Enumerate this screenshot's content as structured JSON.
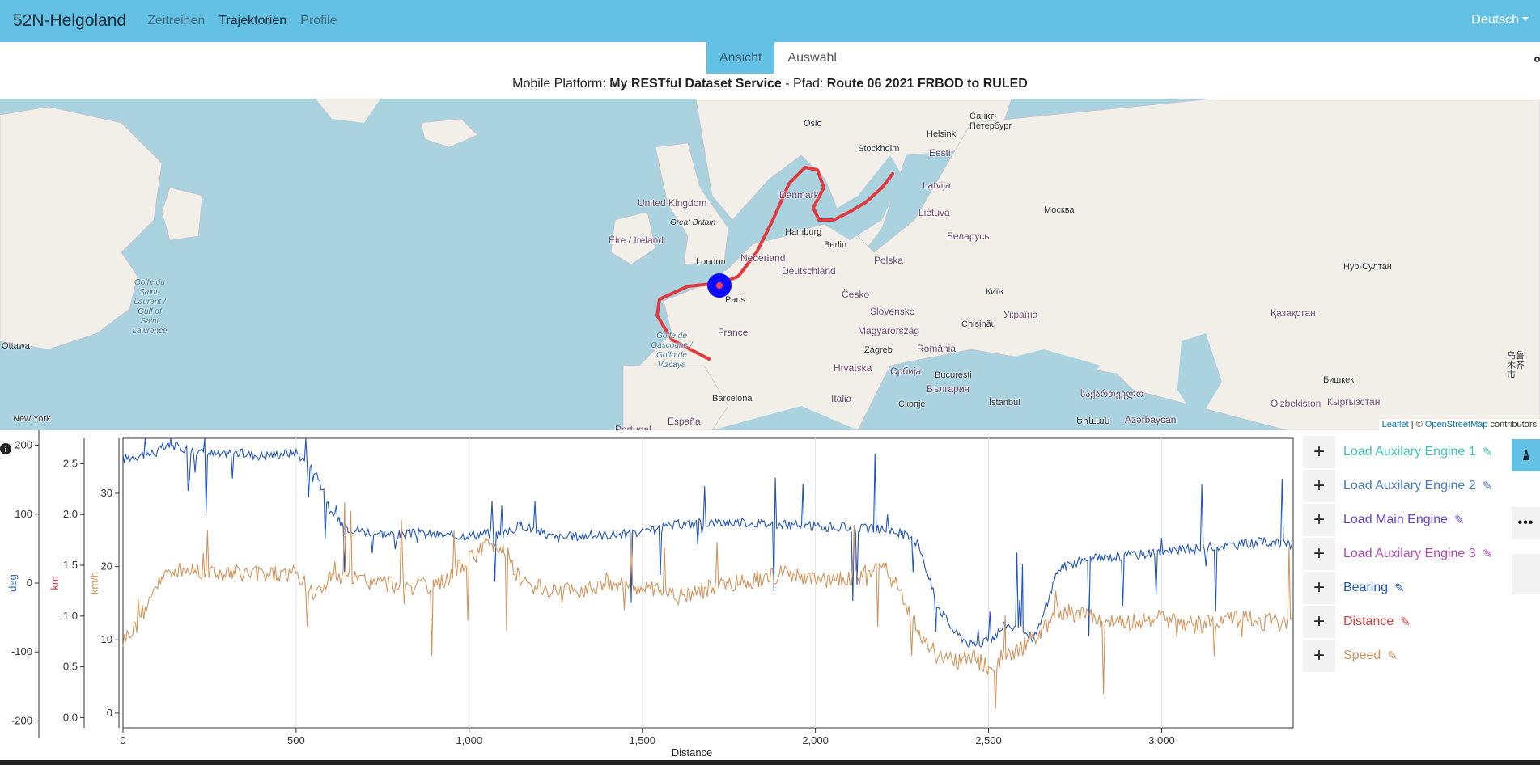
{
  "navbar": {
    "brand": "52N-Helgoland",
    "links": [
      "Zeitreihen",
      "Trajektorien",
      "Profile"
    ],
    "language": "Deutsch"
  },
  "tabs": [
    "Ansicht",
    "Auswahl"
  ],
  "subtitle": {
    "platform_label": "Mobile Platform:",
    "platform_value": "My RESTful Dataset Service",
    "sep": " - ",
    "path_label": "Pfad:",
    "path_value": "Route 06 2021 FRBOD to RULED"
  },
  "map": {
    "labels": {
      "oslo": "Oslo",
      "helsinki": "Helsinki",
      "spb": "Санкт-Петербург",
      "stockholm": "Stockholm",
      "eesti": "Eesti",
      "latvija": "Latvija",
      "lietuva": "Lietuva",
      "moskva": "Москва",
      "belarus": "Беларусь",
      "danmark": "Danmark",
      "uk": "United Kingdom",
      "gb": "Great Britain",
      "eire": "Éire / Ireland",
      "london": "London",
      "hamburg": "Hamburg",
      "berlin": "Berlin",
      "nederland": "Nederland",
      "deutschland": "Deutschland",
      "polska": "Polska",
      "paris": "Paris",
      "cesko": "Česko",
      "kyiv": "Київ",
      "ukraina": "Україна",
      "nur": "Нур-Султан",
      "kazakhstan": "Қазақстан",
      "france": "France",
      "slovensko": "Slovensko",
      "magyar": "Magyarország",
      "chisinau": "Chișinău",
      "zagreb": "Zagreb",
      "romania": "România",
      "hrvatska": "Hrvatska",
      "srbija": "Србија",
      "bucuresti": "București",
      "bulgaria": "България",
      "barcelona": "Barcelona",
      "italia": "Italia",
      "skopje": "Скопје",
      "istanbul": "İstanbul",
      "georgia": "საქართველო",
      "bishkek": "Бишкек",
      "uzbek": "O'zbekiston",
      "kyrgyz": "Кыргызстан",
      "urumqi": "乌鲁木齐市",
      "ottawa": "Ottawa",
      "newyork": "New York",
      "portugal": "Portugal",
      "espana": "España",
      "yerevan": "Երևան",
      "azerbaycan": "Azərbaycan",
      "golfe": "Golfe du Saint-Laurent / Gulf of Saint Lawrence",
      "gascogne": "Golfe de Gascogne / Golfo de Vizcaya"
    },
    "attribution": {
      "leaflet": "Leaflet",
      "sep": " | © ",
      "osm": "OpenStreetMap",
      "suffix": " contributors"
    }
  },
  "chart_data": {
    "type": "line",
    "xlabel": "Distance",
    "xlim": [
      0,
      3380
    ],
    "x_ticks": [
      "0",
      "500",
      "1,000",
      "1,500",
      "2,000",
      "2,500",
      "3,000"
    ],
    "axes": [
      {
        "label": "deg",
        "color": "#3366cc",
        "range": [
          -210,
          210
        ],
        "ticks": [
          "200",
          "100",
          "0",
          "-100",
          "-200"
        ]
      },
      {
        "label": "km",
        "color": "#e0393e",
        "range": [
          -0.1,
          2.75
        ],
        "ticks": [
          "2.5",
          "2.0",
          "1.5",
          "1.0",
          "0.5",
          "0.0"
        ]
      },
      {
        "label": "km/h",
        "color": "#d2955c",
        "range": [
          -2,
          37.5
        ],
        "ticks": [
          "30",
          "20",
          "10",
          "0"
        ]
      }
    ],
    "series": [
      {
        "name": "Bearing",
        "color": "#2255bb",
        "axis": 0,
        "x": [
          0,
          40,
          100,
          110,
          140,
          220,
          290,
          300,
          400,
          500,
          560,
          600,
          650,
          700,
          750,
          800,
          850,
          900,
          950,
          1000,
          1050,
          1100,
          1150,
          1200,
          1250,
          1300,
          1400,
          1500,
          1600,
          1700,
          1800,
          1900,
          2000,
          2100,
          2200,
          2250,
          2300,
          2350,
          2400,
          2450,
          2500,
          2550,
          2600,
          2630,
          2650,
          2700,
          2750,
          2800,
          2900,
          3000,
          3100,
          3200,
          3300,
          3380
        ],
        "y": [
          180,
          185,
          190,
          195,
          200,
          190,
          185,
          190,
          185,
          190,
          160,
          100,
          80,
          75,
          72,
          70,
          72,
          70,
          68,
          70,
          72,
          70,
          85,
          75,
          65,
          68,
          70,
          72,
          85,
          88,
          88,
          85,
          82,
          80,
          78,
          72,
          55,
          -30,
          -70,
          -90,
          -85,
          -60,
          -70,
          -80,
          -60,
          20,
          30,
          35,
          40,
          45,
          50,
          55,
          60,
          55
        ]
      },
      {
        "name": "Speed",
        "color": "#d2955c",
        "axis": 2,
        "x": [
          0,
          40,
          100,
          150,
          200,
          300,
          400,
          500,
          550,
          600,
          650,
          700,
          800,
          900,
          1000,
          1050,
          1100,
          1150,
          1200,
          1300,
          1400,
          1500,
          1600,
          1700,
          1800,
          1900,
          2000,
          2100,
          2200,
          2250,
          2300,
          2350,
          2400,
          2450,
          2500,
          2550,
          2600,
          2650,
          2700,
          2800,
          2900,
          3000,
          3100,
          3200,
          3300,
          3380
        ],
        "y": [
          10,
          12,
          18,
          19.5,
          19.5,
          19,
          19,
          19,
          16,
          18.5,
          18.5,
          18,
          17.5,
          17,
          21,
          23,
          22.5,
          18,
          17,
          16.5,
          18,
          17,
          16,
          17,
          18,
          19,
          18,
          18.5,
          20,
          16,
          11,
          8,
          7,
          8,
          6,
          8,
          9,
          11,
          14,
          13,
          12.5,
          13,
          12,
          13,
          12.5,
          12
        ]
      }
    ]
  },
  "legend": [
    {
      "label": "Load Auxilary Engine 1",
      "color": "#3fc8b8"
    },
    {
      "label": "Load Auxilary Engine 2",
      "color": "#4a78c8"
    },
    {
      "label": "Load Main Engine",
      "color": "#6a3fd0"
    },
    {
      "label": "Load Auxilary Engine 3",
      "color": "#b24ab8"
    },
    {
      "label": "Bearing",
      "color": "#2255bb"
    },
    {
      "label": "Distance",
      "color": "#e0393e"
    },
    {
      "label": "Speed",
      "color": "#c8965c"
    }
  ]
}
